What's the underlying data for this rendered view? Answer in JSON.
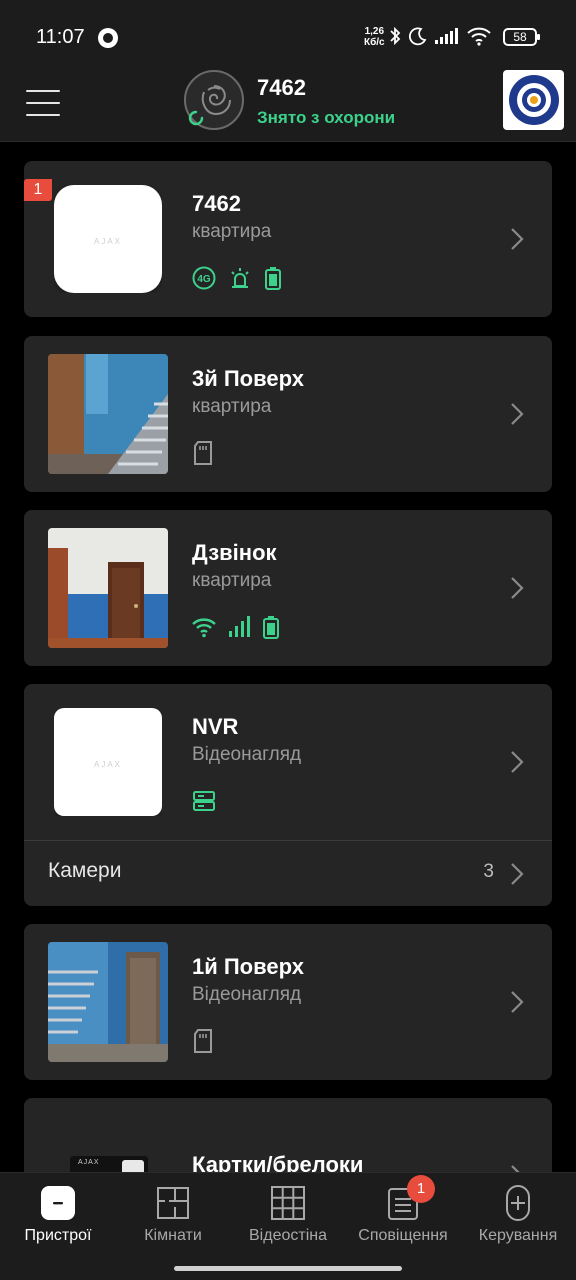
{
  "status_bar": {
    "time": "11:07",
    "speed_value": "1,26",
    "speed_unit": "Кб/с",
    "battery": "58",
    "icons": [
      "recording-icon",
      "bluetooth-icon",
      "moon-icon",
      "signal-icon",
      "wifi-icon"
    ]
  },
  "header": {
    "hub_name": "7462",
    "hub_status": "Знято з охорони",
    "status_color": "#3cd28c"
  },
  "devices": [
    {
      "name": "7462",
      "type": "квартира",
      "notification_badge": "1",
      "brand": "AJAX",
      "status_icons": [
        "4g-icon",
        "siren-icon",
        "battery-icon"
      ]
    },
    {
      "name": "3й Поверх",
      "type": "квартира",
      "status_icons": [
        "sd-card-icon"
      ]
    },
    {
      "name": "Дзвінок",
      "type": "квартира",
      "status_icons": [
        "wifi-icon",
        "signal-icon",
        "battery-icon"
      ]
    },
    {
      "name": "NVR",
      "type": "Відеонагляд",
      "brand": "AJAX",
      "status_icons": [
        "storage-icon"
      ],
      "sub_item": {
        "label": "Камери",
        "count": "3"
      }
    },
    {
      "name": "1й Поверх",
      "type": "Відеонагляд",
      "status_icons": [
        "sd-card-icon"
      ]
    },
    {
      "name": "Картки/брелоки",
      "brand": "AJAX"
    }
  ],
  "bottom_nav": {
    "items": [
      {
        "label": "Пристрої",
        "icon": "devices-icon",
        "active": true
      },
      {
        "label": "Кімнати",
        "icon": "rooms-icon"
      },
      {
        "label": "Відеостіна",
        "icon": "video-wall-icon"
      },
      {
        "label": "Сповіщення",
        "icon": "notifications-icon",
        "badge": "1"
      },
      {
        "label": "Керування",
        "icon": "control-icon"
      }
    ]
  },
  "colors": {
    "accent_green": "#3cd28c",
    "badge_red": "#e74c3c",
    "card_bg": "#252525",
    "bar_bg": "#1c1c1c"
  }
}
